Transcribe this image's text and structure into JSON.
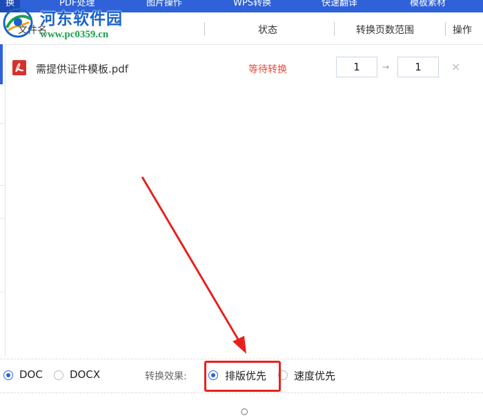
{
  "nav": {
    "tabs": [
      {
        "label": "换",
        "active": true
      },
      {
        "label": "PDF处理",
        "active": false
      },
      {
        "label": "图片操作",
        "active": false
      },
      {
        "label": "WPS转换",
        "active": false
      },
      {
        "label": "快速翻译",
        "active": false
      },
      {
        "label": "模板素材",
        "active": false
      }
    ],
    "bg_color": "#2f62d8"
  },
  "watermark": {
    "title": "河东软件园",
    "url": "www.pc0359.cn"
  },
  "table": {
    "headers": {
      "filename": "文件名",
      "status": "状态",
      "page_range": "转换页数范围",
      "actions": "操作"
    },
    "rows": [
      {
        "icon": "pdf-icon",
        "filename": "需提供证件模板.pdf",
        "status": "等待转换",
        "page_from": "1",
        "page_to": "1",
        "arrow": "→",
        "delete": "×"
      }
    ]
  },
  "options": {
    "formats": [
      {
        "label": "DOC",
        "selected": true
      },
      {
        "label": "DOCX",
        "selected": false
      }
    ],
    "effect_label": "转换效果:",
    "effects": [
      {
        "label": "排版优先",
        "selected": true
      },
      {
        "label": "速度优先",
        "selected": false
      }
    ]
  },
  "colors": {
    "accent": "#2f62d8",
    "status_waiting": "#e74c3c",
    "annotation": "#e8201c"
  }
}
